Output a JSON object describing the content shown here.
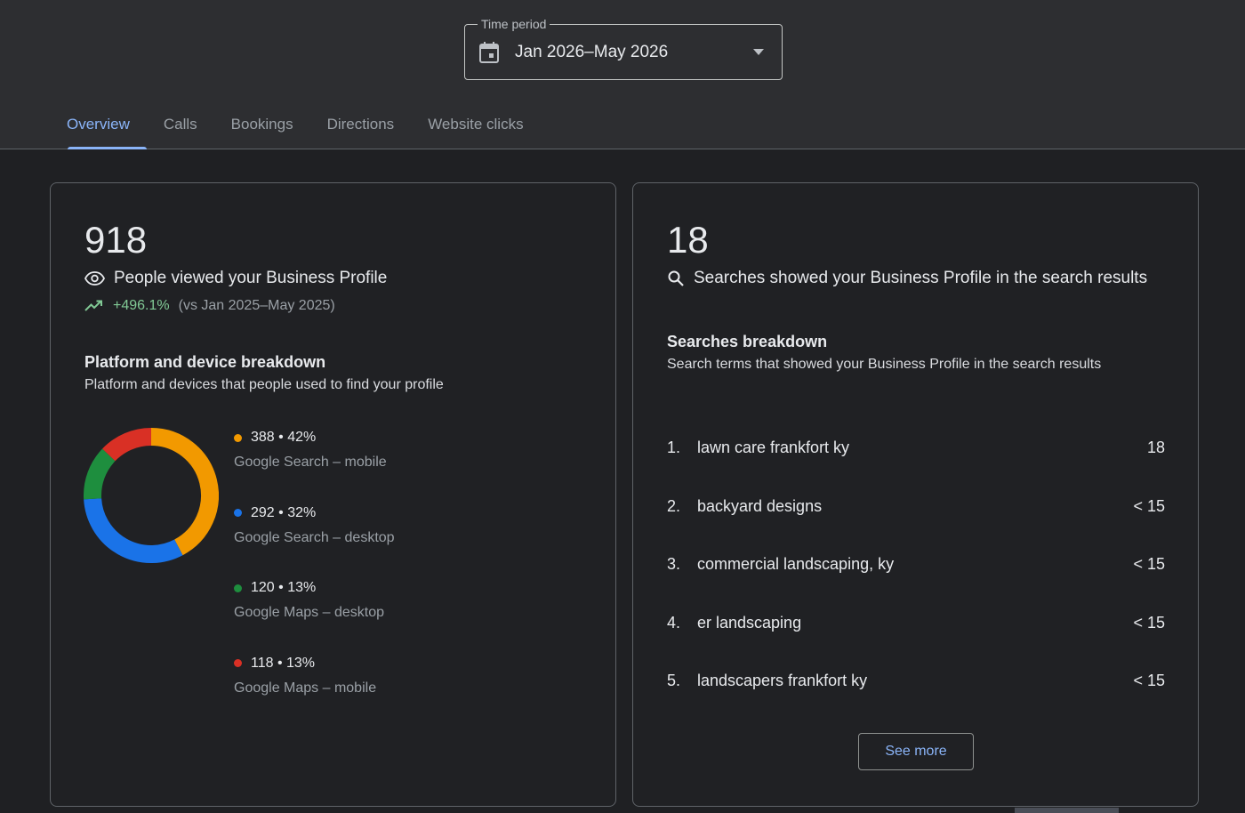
{
  "header": {
    "period_label": "Time period",
    "period_value": "Jan 2026–May 2026"
  },
  "tabs": [
    {
      "label": "Overview",
      "active": true
    },
    {
      "label": "Calls",
      "active": false
    },
    {
      "label": "Bookings",
      "active": false
    },
    {
      "label": "Directions",
      "active": false
    },
    {
      "label": "Website clicks",
      "active": false
    }
  ],
  "views_card": {
    "total": "918",
    "metric_label": "People viewed your Business Profile",
    "trend_value": "+496.1%",
    "trend_compare": "(vs Jan 2025–May 2025)",
    "breakdown_title": "Platform and device breakdown",
    "breakdown_subtitle": "Platform and devices that people used to find your profile"
  },
  "chart_data": {
    "type": "pie",
    "donut": true,
    "series": [
      {
        "name": "Google Search – mobile",
        "value": 388,
        "percent": "42%",
        "color": "#f29900"
      },
      {
        "name": "Google Search – desktop",
        "value": 292,
        "percent": "32%",
        "color": "#1a73e8"
      },
      {
        "name": "Google Maps – desktop",
        "value": 120,
        "percent": "13%",
        "color": "#1e8e3e"
      },
      {
        "name": "Google Maps – mobile",
        "value": 118,
        "percent": "13%",
        "color": "#d93025"
      }
    ]
  },
  "legend_items": [
    {
      "top": "388 • 42%",
      "label": "Google Search – mobile",
      "color": "#f29900"
    },
    {
      "top": "292 • 32%",
      "label": "Google Search – desktop",
      "color": "#1a73e8"
    },
    {
      "top": "120 • 13%",
      "label": "Google Maps – desktop",
      "color": "#1e8e3e"
    },
    {
      "top": "118 • 13%",
      "label": "Google Maps – mobile",
      "color": "#d93025"
    }
  ],
  "searches_card": {
    "total": "18",
    "metric_label": "Searches showed your Business Profile in the search results",
    "breakdown_title": "Searches breakdown",
    "breakdown_subtitle": "Search terms that showed your Business Profile in the search results",
    "see_more_label": "See more"
  },
  "search_terms": [
    {
      "num": "1.",
      "term": "lawn care frankfort ky",
      "count": "18"
    },
    {
      "num": "2.",
      "term": "backyard designs",
      "count": "< 15"
    },
    {
      "num": "3.",
      "term": "commercial landscaping, ky",
      "count": "< 15"
    },
    {
      "num": "4.",
      "term": "er landscaping",
      "count": "< 15"
    },
    {
      "num": "5.",
      "term": "landscapers frankfort ky",
      "count": "< 15"
    }
  ],
  "colors": {
    "accent": "#8ab4f8",
    "positive": "#81c995"
  }
}
